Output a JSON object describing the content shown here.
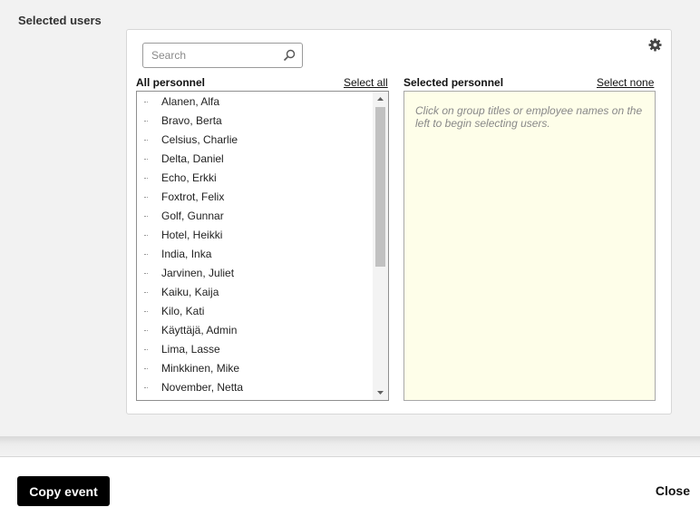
{
  "section": {
    "title": "Selected users"
  },
  "search": {
    "placeholder": "Search",
    "value": ""
  },
  "all_personnel": {
    "heading": "All personnel",
    "select_all_label": "Select all",
    "items": [
      "Alanen, Alfa",
      "Bravo, Berta",
      "Celsius, Charlie",
      "Delta, Daniel",
      "Echo, Erkki",
      "Foxtrot, Felix",
      "Golf, Gunnar",
      "Hotel, Heikki",
      "India, Inka",
      "Jarvinen, Juliet",
      "Kaiku, Kaija",
      "Kilo, Kati",
      "Käyttäjä, Admin",
      "Lima, Lasse",
      "Minkkinen, Mike",
      "November, Netta"
    ]
  },
  "selected_personnel": {
    "heading": "Selected personnel",
    "select_none_label": "Select none",
    "hint": "Click on group titles or employee names on the left to begin selecting users."
  },
  "footer": {
    "copy_event_label": "Copy event",
    "close_label": "Close"
  },
  "icons": {
    "search": "search-icon",
    "settings": "gear-icon",
    "scroll_up": "chevron-up-icon",
    "scroll_down": "chevron-down-icon"
  },
  "colors": {
    "selected_box_bg": "#fefee9",
    "primary_button": "#000000"
  }
}
